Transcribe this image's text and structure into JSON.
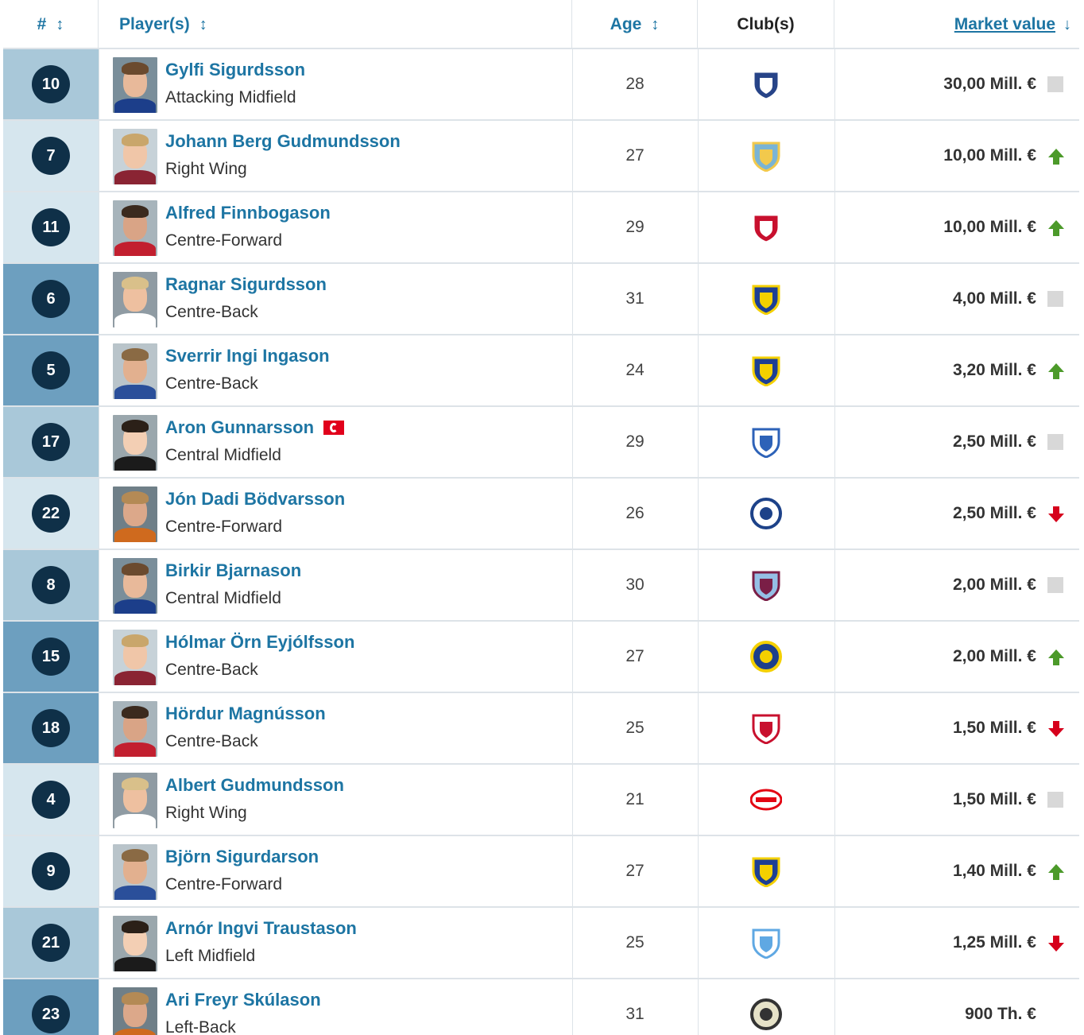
{
  "header": {
    "num": "#",
    "player": "Player(s)",
    "age": "Age",
    "club": "Club(s)",
    "market_value": "Market value",
    "sort_arrow": "↕",
    "sort_active_arrow": "↓"
  },
  "colors": {
    "link": "#1d75a3",
    "badge": "#0f3048",
    "gk_cell": "#d6e6ee",
    "def_cell": "#6d9fbf",
    "mid_cell": "#a9c8d9",
    "fwd_cell": "#d6e6ee",
    "trend_up": "#4c9a2a",
    "trend_down": "#d6001c",
    "trend_flat": "#d8d8d8"
  },
  "rows": [
    {
      "number": "10",
      "name": "Gylfi Sigurdsson",
      "position": "Attacking Midfield",
      "age": "28",
      "club_icon": "everton-crest-icon",
      "value": "30,00 Mill. €",
      "trend": "flat",
      "pos_group": "mid",
      "captain": false
    },
    {
      "number": "7",
      "name": "Johann Berg Gudmundsson",
      "position": "Right Wing",
      "age": "27",
      "club_icon": "burnley-crest-icon",
      "value": "10,00 Mill. €",
      "trend": "up",
      "pos_group": "fwd",
      "captain": false
    },
    {
      "number": "11",
      "name": "Alfred Finnbogason",
      "position": "Centre-Forward",
      "age": "29",
      "club_icon": "augsburg-crest-icon",
      "value": "10,00 Mill. €",
      "trend": "up",
      "pos_group": "fwd",
      "captain": false
    },
    {
      "number": "6",
      "name": "Ragnar Sigurdsson",
      "position": "Centre-Back",
      "age": "31",
      "club_icon": "rostov-crest-icon",
      "value": "4,00 Mill. €",
      "trend": "flat",
      "pos_group": "def",
      "captain": false
    },
    {
      "number": "5",
      "name": "Sverrir Ingi Ingason",
      "position": "Centre-Back",
      "age": "24",
      "club_icon": "rostov-crest-icon",
      "value": "3,20 Mill. €",
      "trend": "up",
      "pos_group": "def",
      "captain": false
    },
    {
      "number": "17",
      "name": "Aron Gunnarsson",
      "position": "Central Midfield",
      "age": "29",
      "club_icon": "cardiff-crest-icon",
      "value": "2,50 Mill. €",
      "trend": "flat",
      "pos_group": "mid",
      "captain": true
    },
    {
      "number": "22",
      "name": "Jón Dadi Bödvarsson",
      "position": "Centre-Forward",
      "age": "26",
      "club_icon": "reading-crest-icon",
      "value": "2,50 Mill. €",
      "trend": "down",
      "pos_group": "fwd",
      "captain": false
    },
    {
      "number": "8",
      "name": "Birkir Bjarnason",
      "position": "Central Midfield",
      "age": "30",
      "club_icon": "aston-villa-crest-icon",
      "value": "2,00 Mill. €",
      "trend": "flat",
      "pos_group": "mid",
      "captain": false
    },
    {
      "number": "15",
      "name": "Hólmar Örn Eyjólfsson",
      "position": "Centre-Back",
      "age": "27",
      "club_icon": "levski-crest-icon",
      "value": "2,00 Mill. €",
      "trend": "up",
      "pos_group": "def",
      "captain": false
    },
    {
      "number": "18",
      "name": "Hördur Magnússon",
      "position": "Centre-Back",
      "age": "25",
      "club_icon": "bristol-city-crest-icon",
      "value": "1,50 Mill. €",
      "trend": "down",
      "pos_group": "def",
      "captain": false
    },
    {
      "number": "4",
      "name": "Albert Gudmundsson",
      "position": "Right Wing",
      "age": "21",
      "club_icon": "psv-crest-icon",
      "value": "1,50 Mill. €",
      "trend": "flat",
      "pos_group": "fwd",
      "captain": false
    },
    {
      "number": "9",
      "name": "Björn Sigurdarson",
      "position": "Centre-Forward",
      "age": "27",
      "club_icon": "rostov-crest-icon",
      "value": "1,40 Mill. €",
      "trend": "up",
      "pos_group": "fwd",
      "captain": false
    },
    {
      "number": "21",
      "name": "Arnór Ingvi Traustason",
      "position": "Left Midfield",
      "age": "25",
      "club_icon": "malmo-crest-icon",
      "value": "1,25 Mill. €",
      "trend": "down",
      "pos_group": "mid",
      "captain": false
    },
    {
      "number": "23",
      "name": "Ari Freyr Skúlason",
      "position": "Left-Back",
      "age": "31",
      "club_icon": "lokeren-crest-icon",
      "value": "900 Th. €",
      "trend": "none",
      "pos_group": "def",
      "captain": false
    }
  ]
}
